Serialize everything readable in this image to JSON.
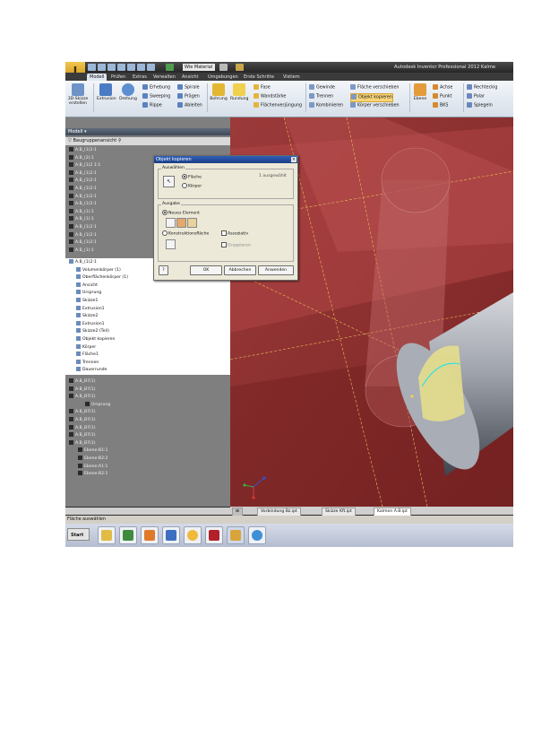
{
  "app": {
    "title": "Autodesk Inventor Professional 2012   Kalme",
    "material": "Wie Material"
  },
  "tabs": [
    "Modell",
    "Prüfen",
    "Extras",
    "Verwalten",
    "Ansicht",
    "Umgebungen",
    "Erste Schritte",
    "Vistiem"
  ],
  "ribbon": {
    "big": [
      "3D-Skizze erstellen",
      "Extrusion",
      "Drehung",
      "Bohrung",
      "Rundung",
      "Ebene"
    ],
    "small": [
      "Erhebung",
      "Sweeping",
      "Rippe",
      "Spirale",
      "Prägen",
      "Ableiten",
      "Fase",
      "Wandstärke",
      "Flächenverjüngung",
      "Gewinde",
      "Trennen",
      "Kombinieren",
      "Fläche verschieben",
      "Objekt kopieren",
      "Körper verschieben",
      "Achse",
      "Punkt",
      "BKS",
      "Rechteckig",
      "Polar",
      "Spiegeln"
    ]
  },
  "browser": {
    "header": "Modell ▾",
    "filter": "Baugruppenansicht",
    "rows_top": [
      "A.B_(1)2:1",
      "A.B_(2):1",
      "A.B_(1)2 1:1",
      "A.B_(1)2:1",
      "A.B_(1)2:1",
      "A.B_(1)2:1",
      "A.B_(1)2:1",
      "A.B_(1)2:1",
      "A.B_(1):1",
      "A.B_(1):1",
      "A.B_(1)2:1",
      "A.B_(1)2:1",
      "A.B_(1)2:1",
      "A.B_(1):1"
    ],
    "rows_white": [
      "A.B_(1)2:1",
      "Volumenkörper (1)",
      "Oberflächenkörper (1)",
      "Ansicht",
      "Ursprung",
      "Skizze1",
      "Extrusion1",
      "Skizze2",
      "Extrusion1",
      "Skizze2 (Teil)",
      "Objekt kopieren",
      "Körper",
      "Fläche1",
      "Trennen",
      "Dauerrunde"
    ],
    "rows_bottom": [
      "A.B_B7(1)",
      "A.B_B7(1)",
      "A.B_B7(1)",
      "Ursprung",
      "A.B_B7(1)",
      "A.B_B7(1)",
      "A.B_B7(1)",
      "A.B_B7(1)",
      "A.B_B7(1)",
      "Ebene:B1:1",
      "Ebene:B2:2",
      "Ebene:A1:1",
      "Ebene:B2:1"
    ]
  },
  "dialog": {
    "title": "Objekt kopieren",
    "group_select": "Auswählen",
    "radio_faces": "Fläche",
    "radio_bodies": "Körper",
    "selection_count": "1 ausgewählt",
    "group_output": "Ausgabe",
    "radio_new_element": "Neues Element",
    "radio_construction": "Konstruktionsfläche",
    "check_assoc": "Assoziativ",
    "check_group": "Gruppieren",
    "ok": "OK",
    "cancel": "Abbrechen",
    "apply": "Anwenden",
    "close_glyph": "×",
    "help_glyph": "?"
  },
  "doc_tabs": [
    "Vorbindung Bz.ipt",
    "Skizze Kft.ipt",
    "Kalmen A.B.ipt"
  ],
  "status": "Fläche auswählen",
  "taskbar": {
    "start": "Start"
  },
  "colors": {
    "viewport": "#8a2f2f",
    "cylinder": "#a8acb4",
    "highlight": "#f2e88a"
  }
}
